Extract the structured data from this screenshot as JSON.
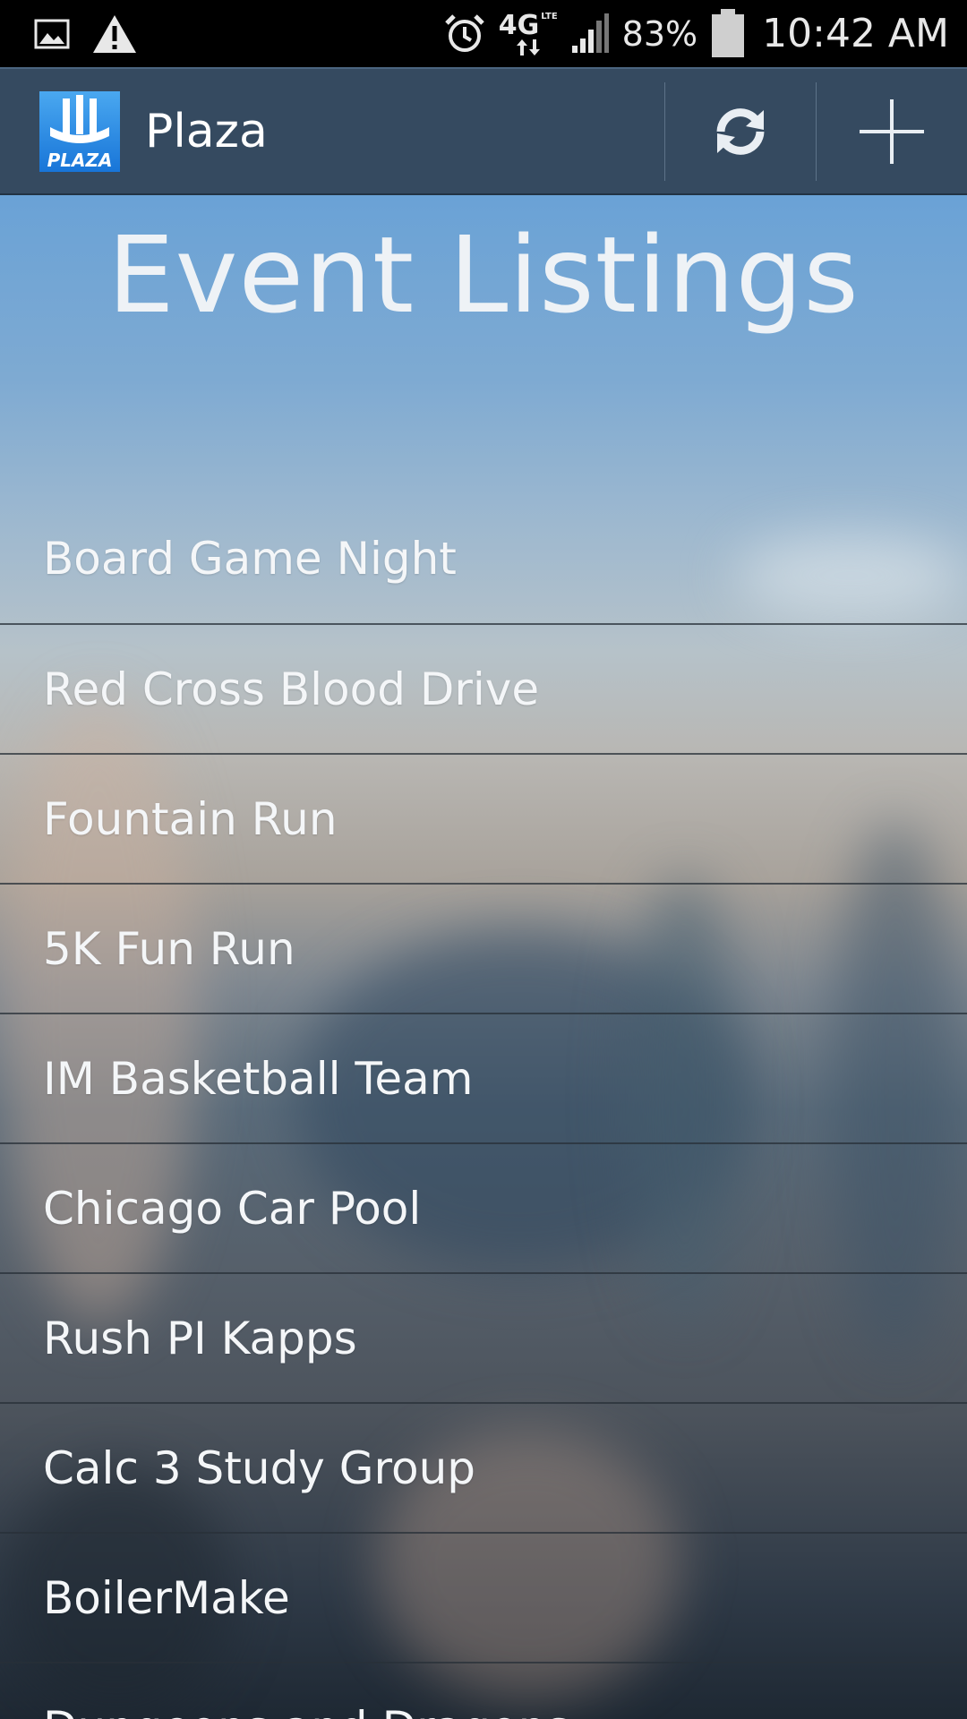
{
  "status_bar": {
    "battery_percent": "83%",
    "time": "10:42 AM",
    "network": "4G",
    "network_sub": "LTE",
    "icons": [
      "image-icon",
      "warning-icon",
      "alarm-icon",
      "network-4g-lte-icon",
      "signal-icon",
      "battery-icon"
    ]
  },
  "action_bar": {
    "app_name": "Plaza",
    "logo_text": "PLAZA",
    "actions": [
      {
        "name": "refresh",
        "icon": "refresh-icon"
      },
      {
        "name": "add",
        "icon": "plus-icon"
      }
    ]
  },
  "page": {
    "heading": "Event Listings"
  },
  "events": [
    {
      "label": "Board Game Night"
    },
    {
      "label": "Red Cross Blood Drive"
    },
    {
      "label": "Fountain Run"
    },
    {
      "label": "5K Fun Run"
    },
    {
      "label": "IM Basketball Team"
    },
    {
      "label": "Chicago Car Pool"
    },
    {
      "label": "Rush PI Kapps"
    },
    {
      "label": "Calc 3 Study Group"
    },
    {
      "label": "BoilerMake"
    },
    {
      "label": "Dungeons and Dragons"
    }
  ],
  "colors": {
    "action_bar": "#354a60",
    "status_bar": "#000000",
    "logo_blue": "#1e88e5",
    "text": "#f4f6f8"
  }
}
